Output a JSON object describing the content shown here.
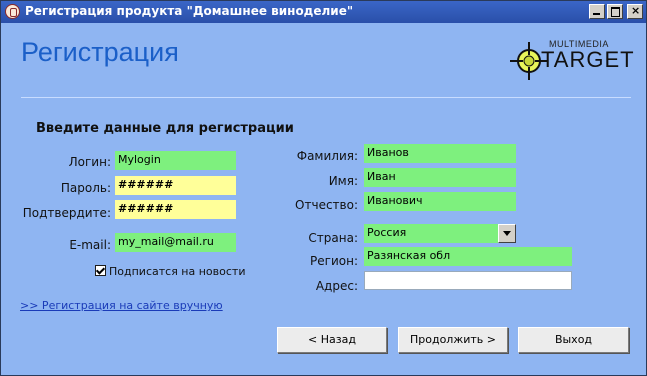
{
  "window": {
    "title": "Регистрация продукта \"Домашнее виноделие\"",
    "controls": {
      "minimize": "minimize",
      "maximize": "maximize",
      "close": "×"
    }
  },
  "header": {
    "heading": "Регистрация",
    "logo": {
      "small": "MULTIMEDIA",
      "big": "TARGET"
    }
  },
  "form": {
    "section_title": "Введите данные для регистрации",
    "login": {
      "label": "Логин:",
      "value": "Mylogin"
    },
    "password": {
      "label": "Пароль:",
      "value": "######"
    },
    "confirm": {
      "label": "Подтвердите:",
      "value": "######"
    },
    "email": {
      "label": "E-mail:",
      "value": "my_mail@mail.ru"
    },
    "newsletter": {
      "label": "Подписатся на новости",
      "checked": true
    },
    "lastname": {
      "label": "Фамилия:",
      "value": "Иванов"
    },
    "firstname": {
      "label": "Имя:",
      "value": "Иван"
    },
    "patronymic": {
      "label": "Отчество:",
      "value": "Иванович"
    },
    "country": {
      "label": "Страна:",
      "value": "Россия"
    },
    "region": {
      "label": "Регион:",
      "value": "Разянская обл"
    },
    "address": {
      "label": "Адрес:",
      "value": ""
    },
    "manual_link": ">> Регистрация на сайте вручную"
  },
  "buttons": {
    "back": "< Назад",
    "next": "Продолжить >",
    "exit": "Выход"
  },
  "colors": {
    "background": "#8fb5f2",
    "heading": "#1b5fc8",
    "field_green": "#7ef07e",
    "field_yellow": "#ffff99"
  }
}
